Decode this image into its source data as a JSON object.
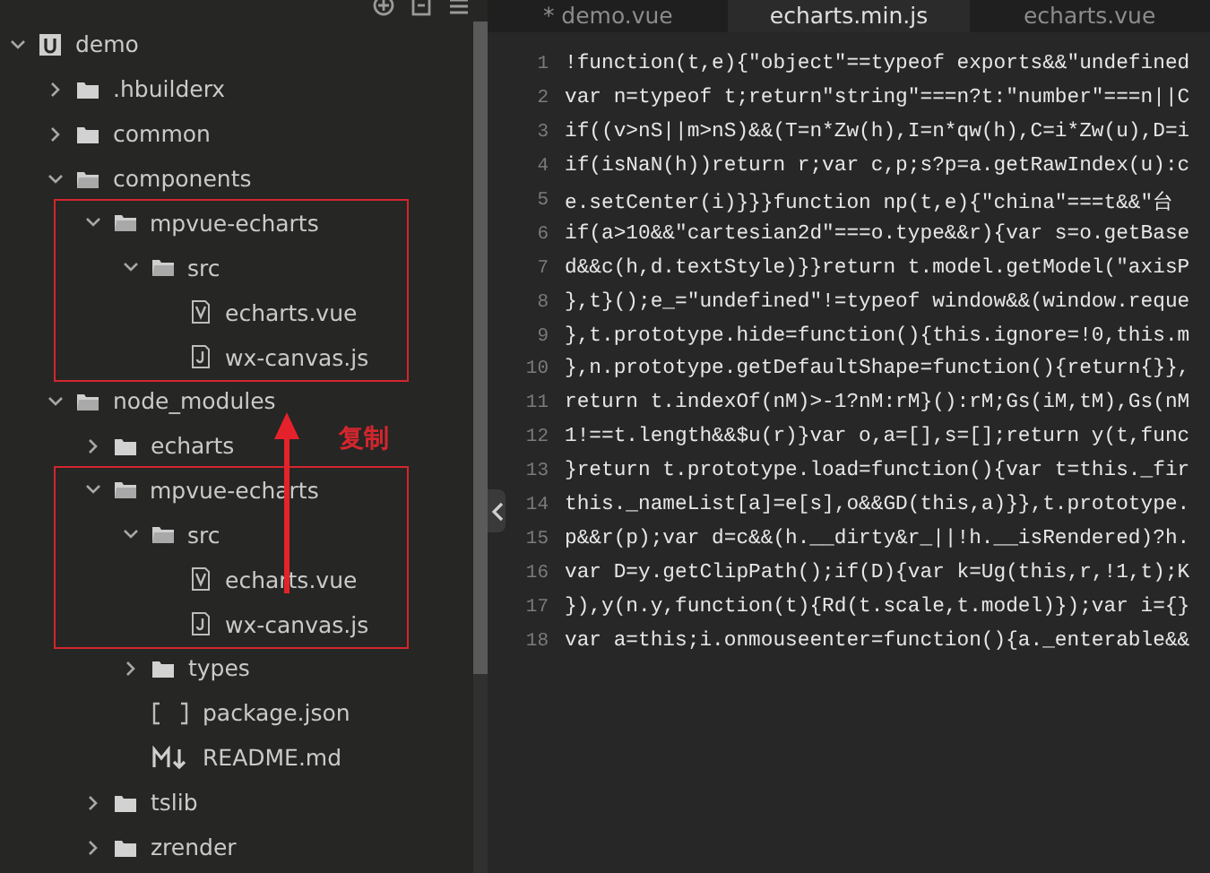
{
  "sidebar": {
    "tree": [
      {
        "name": "demo",
        "kind": "project",
        "expanded": true,
        "children": [
          {
            "name": ".hbuilderx",
            "kind": "folder",
            "expanded": false
          },
          {
            "name": "common",
            "kind": "folder",
            "expanded": false
          },
          {
            "name": "components",
            "kind": "folder",
            "expanded": true,
            "children": [
              {
                "name": "mpvue-echarts",
                "kind": "folder",
                "expanded": true,
                "highlighted": true,
                "children": [
                  {
                    "name": "src",
                    "kind": "folder",
                    "expanded": true,
                    "highlighted": true,
                    "children": [
                      {
                        "name": "echarts.vue",
                        "kind": "vue"
                      },
                      {
                        "name": "wx-canvas.js",
                        "kind": "js"
                      }
                    ]
                  }
                ]
              }
            ]
          },
          {
            "name": "node_modules",
            "kind": "folder",
            "expanded": true,
            "children": [
              {
                "name": "echarts",
                "kind": "folder",
                "expanded": false
              },
              {
                "name": "mpvue-echarts",
                "kind": "folder",
                "expanded": true,
                "highlighted": true,
                "children": [
                  {
                    "name": "src",
                    "kind": "folder",
                    "expanded": true,
                    "highlighted": true,
                    "children": [
                      {
                        "name": "echarts.vue",
                        "kind": "vue"
                      },
                      {
                        "name": "wx-canvas.js",
                        "kind": "js"
                      }
                    ]
                  },
                  {
                    "name": "types",
                    "highlighted": false,
                    "kind": "folder",
                    "expanded": false
                  },
                  {
                    "name": "package.json",
                    "kind": "json"
                  },
                  {
                    "name": "README.md",
                    "kind": "md"
                  }
                ]
              },
              {
                "name": "tslib",
                "kind": "folder",
                "expanded": false
              },
              {
                "name": "zrender",
                "kind": "folder",
                "expanded": false
              }
            ]
          }
        ]
      }
    ]
  },
  "annotation": {
    "label": "复制"
  },
  "tabs": [
    {
      "label": "* demo.vue",
      "selected": false
    },
    {
      "label": "echarts.min.js",
      "selected": true
    },
    {
      "label": "echarts.vue",
      "selected": false
    }
  ],
  "code_lines": [
    {
      "number": "1",
      "text": "!function(t,e){\"object\"==typeof exports&&\"undefined"
    },
    {
      "number": "2",
      "text": "var n=typeof t;return\"string\"===n?t:\"number\"===n||C"
    },
    {
      "number": "3",
      "text": "if((v>nS||m>nS)&&(T=n*Zw(h),I=n*qw(h),C=i*Zw(u),D=i"
    },
    {
      "number": "4",
      "text": "if(isNaN(h))return r;var c,p;s?p=a.getRawIndex(u):c"
    },
    {
      "number": "5",
      "text": "e.setCenter(i)}}}function np(t,e){\"china\"===t&&\"台"
    },
    {
      "number": "6",
      "text": "if(a>10&&\"cartesian2d\"===o.type&&r){var s=o.getBase"
    },
    {
      "number": "7",
      "text": "d&&c(h,d.textStyle)}}return t.model.getModel(\"axisP"
    },
    {
      "number": "8",
      "text": "},t}();e_=\"undefined\"!=typeof window&&(window.reque"
    },
    {
      "number": "9",
      "text": "},t.prototype.hide=function(){this.ignore=!0,this.m"
    },
    {
      "number": "10",
      "text": "},n.prototype.getDefaultShape=function(){return{}},"
    },
    {
      "number": "11",
      "text": "return t.indexOf(nM)>-1?nM:rM}():rM;Gs(iM,tM),Gs(nM"
    },
    {
      "number": "12",
      "text": "1!==t.length&&$u(r)}var o,a=[],s=[];return y(t,func"
    },
    {
      "number": "13",
      "text": "}return t.prototype.load=function(){var t=this._fir"
    },
    {
      "number": "14",
      "text": "this._nameList[a]=e[s],o&&GD(this,a)}},t.prototype."
    },
    {
      "number": "15",
      "text": "p&&r(p);var d=c&&(h.__dirty&r_||!h.__isRendered)?h."
    },
    {
      "number": "16",
      "text": "var D=y.getClipPath();if(D){var k=Ug(this,r,!1,t);K"
    },
    {
      "number": "17",
      "text": "}),y(n.y,function(t){Rd(t.scale,t.model)});var i={}"
    },
    {
      "number": "18",
      "text": "var a=this;i.onmouseenter=function(){a._enterable&&"
    }
  ]
}
